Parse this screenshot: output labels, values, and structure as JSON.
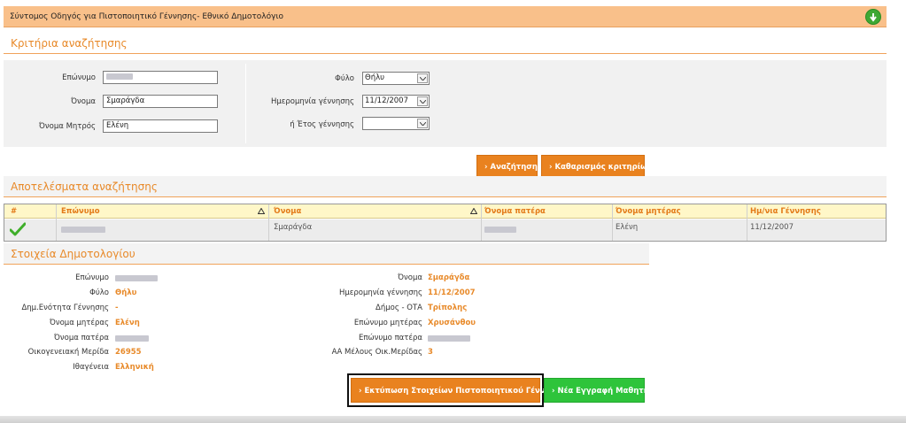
{
  "header": {
    "title": "Σύντομος Οδηγός για Πιστοποιητικό Γέννησης- Εθνικό Δημοτολόγιο"
  },
  "criteria": {
    "section_title": "Κριτήρια αναζήτησης",
    "surname_label": "Επώνυμο",
    "name_label": "Όνομα",
    "name_value": "Σμαράγδα",
    "mother_label": "Όνομα Μητρός",
    "mother_value": "Ελένη",
    "gender_label": "Φύλο",
    "gender_value": "Θήλυ",
    "birthdate_label": "Ημερομηνία γέννησης",
    "birthdate_value": "11/12/2007",
    "year_label": "ή Έτος γέννησης",
    "year_value": ""
  },
  "buttons": {
    "search": "Αναζήτηση",
    "clear": "Καθαρισμός κριτηρίων",
    "print": "Εκτύπωση Στοιχείων Πιστοποιητικού Γέννησης",
    "new_student": "Νέα Εγγραφή Μαθητή"
  },
  "results": {
    "section_title": "Αποτελέσματα αναζήτησης",
    "columns": [
      "#",
      "Επώνυμο",
      "Όνομα",
      "Όνομα πατέρα",
      "Όνομα μητέρας",
      "Ημ/νια Γέννησης"
    ],
    "row": {
      "name": "Σμαράγδα",
      "mother": "Ελένη",
      "birthdate": "11/12/2007"
    }
  },
  "registry": {
    "section_title": "Στοιχεία Δημοτολογίου",
    "left": [
      {
        "label": "Επώνυμο",
        "value": ""
      },
      {
        "label": "Φύλο",
        "value": "Θήλυ"
      },
      {
        "label": "Δημ.Ενότητα Γέννησης",
        "value": "-"
      },
      {
        "label": "Όνομα μητέρας",
        "value": "Ελένη"
      },
      {
        "label": "Όνομα πατέρα",
        "value": ""
      },
      {
        "label": "Οικογενειακή Μερίδα",
        "value": "26955"
      },
      {
        "label": "Ιθαγένεια",
        "value": "Ελληνική"
      }
    ],
    "right": [
      {
        "label": "Όνομα",
        "value": "Σμαράγδα"
      },
      {
        "label": "Ημερομηνία γέννησης",
        "value": "11/12/2007"
      },
      {
        "label": "Δήμος - ΟΤΑ",
        "value": "Τρίπολης"
      },
      {
        "label": "Επώνυμο μητέρας",
        "value": "Χρυσάνθου"
      },
      {
        "label": "Επώνυμο πατέρα",
        "value": ""
      },
      {
        "label": "ΑΑ Μέλους Οικ.Μερίδας",
        "value": "3"
      }
    ]
  },
  "colors": {
    "accent": "#e9821f",
    "header": "#f9c08a",
    "success": "#2ec43b"
  },
  "icons": [
    "arrow-down-icon",
    "sort-icon",
    "checkmark-icon",
    "chevron-right-icon",
    "dropdown-arrow-icon"
  ]
}
